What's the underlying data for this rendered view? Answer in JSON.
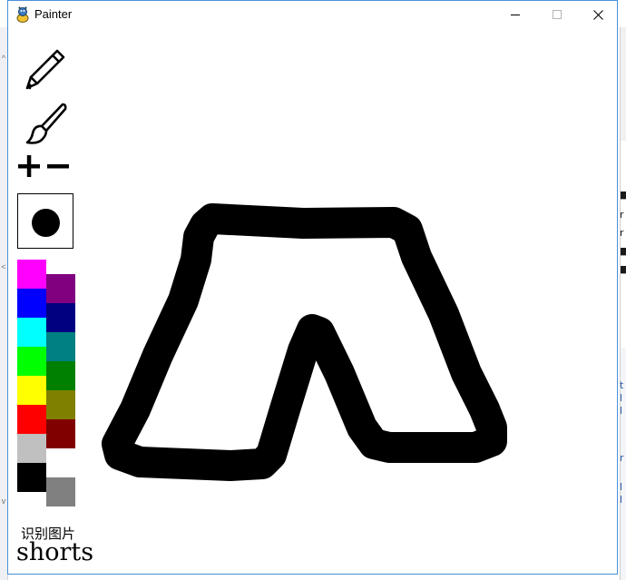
{
  "window": {
    "title": "Painter",
    "controls": [
      "minimize",
      "maximize",
      "close"
    ]
  },
  "tools": {
    "pencil": "pencil-icon",
    "brush": "brush-icon",
    "increase": "plus-icon",
    "decrease": "minus-icon"
  },
  "brush_preview": {
    "shape": "circle",
    "color": "#000000"
  },
  "palette": {
    "left_column": [
      "#ff00ff",
      "#0000ff",
      "#00ffff",
      "#00ff00",
      "#ffff00",
      "#ff0000",
      "#c0c0c0",
      "#000000"
    ],
    "right_column": [
      "#800080",
      "#000080",
      "#008080",
      "#008000",
      "#808000",
      "#800000",
      "#ffffff",
      "#808080"
    ]
  },
  "status": {
    "recognize_label": "识别图片",
    "result": "shorts"
  },
  "canvas": {
    "background": "#ffffff",
    "stroke_color": "#000000",
    "drawing": "shorts sketch"
  }
}
